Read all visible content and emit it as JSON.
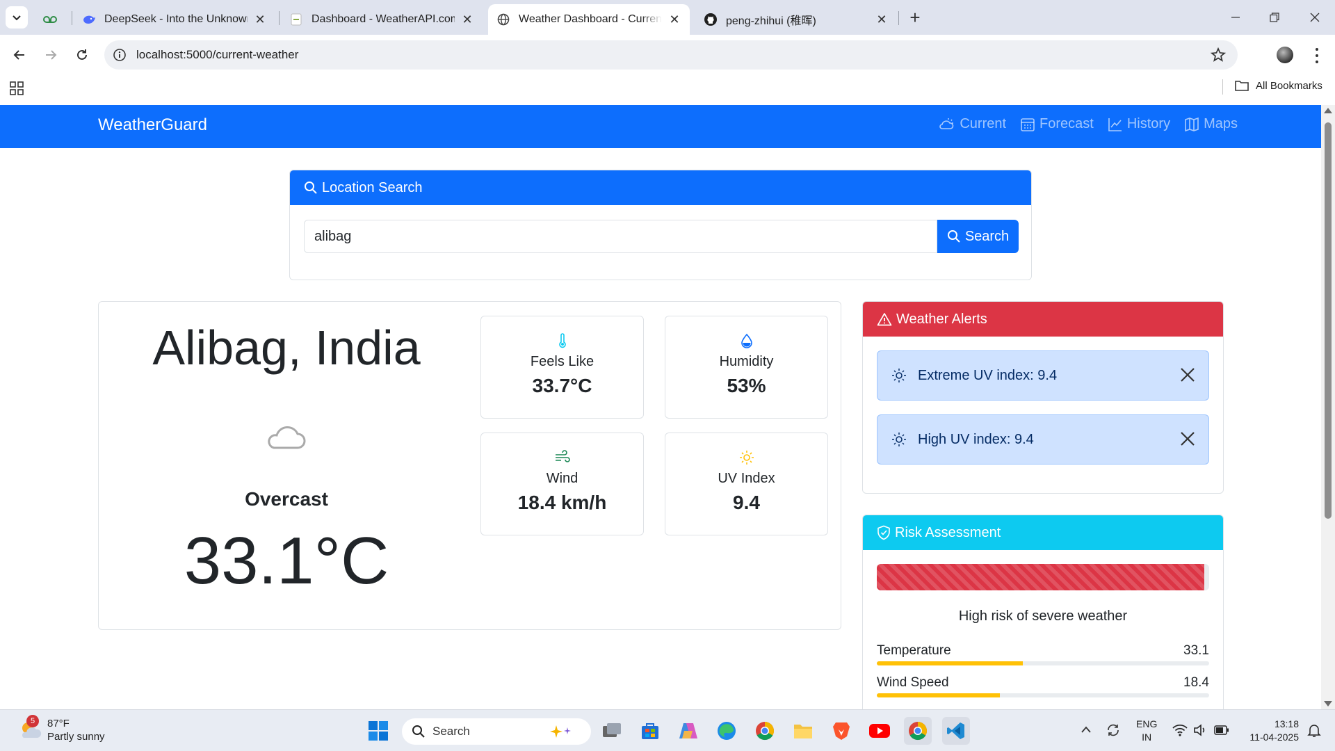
{
  "browser": {
    "tabs": [
      {
        "title": "",
        "icon": "geeksforgeeks-icon",
        "active": false
      },
      {
        "title": "DeepSeek - Into the Unknown",
        "icon": "deepseek-icon",
        "active": false
      },
      {
        "title": "Dashboard - WeatherAPI.com",
        "icon": "weatherapi-icon",
        "active": false
      },
      {
        "title": "Weather Dashboard - Current W",
        "icon": "globe-icon",
        "active": true
      },
      {
        "title": "peng-zhihui (稚晖)",
        "icon": "github-icon",
        "active": false
      }
    ],
    "url": "localhost:5000/current-weather",
    "bookmarks_label": "All Bookmarks"
  },
  "app": {
    "brand": "WeatherGuard",
    "nav": [
      {
        "label": "Current",
        "icon": "cloud-sun-icon"
      },
      {
        "label": "Forecast",
        "icon": "calendar-icon"
      },
      {
        "label": "History",
        "icon": "graph-up-icon"
      },
      {
        "label": "Maps",
        "icon": "map-icon"
      }
    ],
    "accent": "#0d6efd"
  },
  "search": {
    "title": "Location Search",
    "value": "alibag",
    "button": "Search"
  },
  "current": {
    "location": "Alibag, India",
    "condition": "Overcast",
    "temperature": "33.1°C",
    "icon": "cloud-icon",
    "stats": [
      {
        "label": "Feels Like",
        "value": "33.7°C",
        "icon": "thermometer-icon"
      },
      {
        "label": "Humidity",
        "value": "53%",
        "icon": "droplet-icon"
      },
      {
        "label": "Wind",
        "value": "18.4 km/h",
        "icon": "wind-icon"
      },
      {
        "label": "UV Index",
        "value": "9.4",
        "icon": "sun-icon"
      }
    ]
  },
  "alerts": {
    "title": "Weather Alerts",
    "color": "#dc3545",
    "items": [
      {
        "text": "Extreme UV index: 9.4"
      },
      {
        "text": "High UV index: 9.4"
      }
    ]
  },
  "risk": {
    "title": "Risk Assessment",
    "color": "#0dcaf0",
    "level_fraction": 0.985,
    "summary": "High risk of severe weather",
    "metrics": [
      {
        "label": "Temperature",
        "value": "33.1",
        "fraction": 0.44
      },
      {
        "label": "Wind Speed",
        "value": "18.4",
        "fraction": 0.37
      }
    ]
  },
  "taskbar": {
    "weather_temp": "87°F",
    "weather_desc": "Partly sunny",
    "weather_badge": "5",
    "search_placeholder": "Search",
    "lang_top": "ENG",
    "lang_bottom": "IN",
    "time": "13:18",
    "date": "11-04-2025"
  }
}
